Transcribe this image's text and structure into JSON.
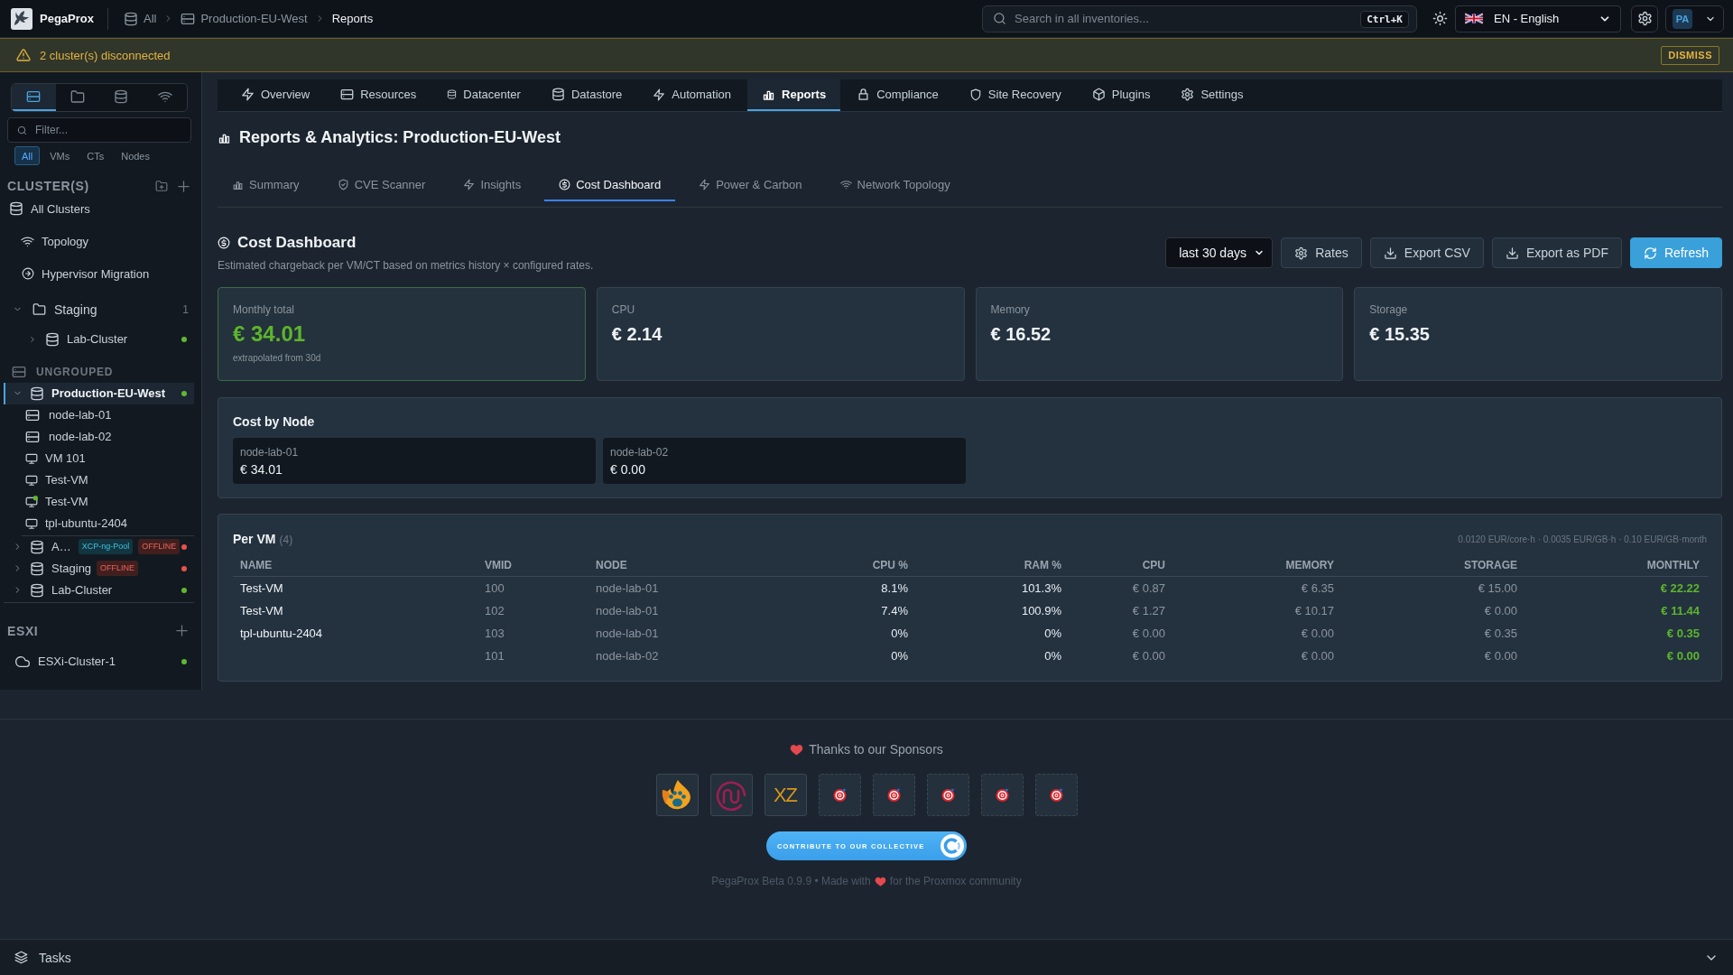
{
  "app": {
    "name": "PegaProx"
  },
  "breadcrumbs": [
    {
      "label": "All",
      "current": false
    },
    {
      "label": "Production-EU-West",
      "current": false
    },
    {
      "label": "Reports",
      "current": true
    }
  ],
  "search": {
    "placeholder": "Search in all inventories...",
    "shortcut": "Ctrl+K"
  },
  "language": {
    "value": "EN - English"
  },
  "user": {
    "initials": "PA"
  },
  "banner": {
    "message": "2 cluster(s) disconnected",
    "action": "DISMISS"
  },
  "sidebar": {
    "view_tabs": [
      {
        "selected": true
      },
      {
        "selected": false
      },
      {
        "selected": false
      },
      {
        "selected": false
      }
    ],
    "filter": {
      "placeholder": "Filter..."
    },
    "type_filters": [
      {
        "label": "All",
        "selected": true
      },
      {
        "label": "VMs",
        "selected": false
      },
      {
        "label": "CTs",
        "selected": false
      },
      {
        "label": "Nodes",
        "selected": false
      }
    ],
    "clusters_title": "CLUSTER(S)",
    "links": [
      {
        "label": "All Clusters"
      },
      {
        "label": "Topology"
      },
      {
        "label": "Hypervisor Migration"
      }
    ],
    "groups": [
      {
        "name": "Staging",
        "count": "1",
        "expanded": true,
        "clusters": [
          {
            "name": "Lab-Cluster",
            "expanded": false,
            "color": "#5fb832"
          }
        ]
      }
    ],
    "ungrouped": {
      "title": "UNGROUPED",
      "clusters": [
        {
          "name": "Production-EU-West",
          "selected": true,
          "expanded": true,
          "color": "#5fb832",
          "children": [
            {
              "name": "node-lab-01",
              "kind": "node"
            },
            {
              "name": "node-lab-02",
              "kind": "node"
            },
            {
              "name": "VM 101",
              "kind": "vm",
              "running": false
            },
            {
              "name": "Test-VM",
              "kind": "vm",
              "running": false
            },
            {
              "name": "Test-VM",
              "kind": "vm",
              "running": true
            },
            {
              "name": "tpl-ubuntu-2404",
              "kind": "vm",
              "running": false
            }
          ]
        },
        {
          "name": "A…",
          "selected": false,
          "expanded": false,
          "color": "#e5534b",
          "badges": [
            {
              "label": "XCP-ng-Pool",
              "kind": "type"
            },
            {
              "label": "OFFLINE",
              "kind": "offline"
            }
          ]
        },
        {
          "name": "Staging",
          "selected": false,
          "expanded": false,
          "color": "#e5534b",
          "badges": [
            {
              "label": "OFFLINE",
              "kind": "offline"
            }
          ]
        },
        {
          "name": "Lab-Cluster",
          "selected": false,
          "expanded": false,
          "color": "#5fb832"
        }
      ]
    },
    "esxi": {
      "title": "ESXI",
      "clusters": [
        {
          "name": "ESXi-Cluster-1",
          "color": "#5fb832"
        }
      ]
    }
  },
  "main": {
    "tabs": [
      {
        "label": "Overview",
        "selected": false
      },
      {
        "label": "Resources",
        "selected": false
      },
      {
        "label": "Datacenter",
        "selected": false
      },
      {
        "label": "Datastore",
        "selected": false
      },
      {
        "label": "Automation",
        "selected": false
      },
      {
        "label": "Reports",
        "selected": true
      },
      {
        "label": "Compliance",
        "selected": false
      },
      {
        "label": "Site Recovery",
        "selected": false
      },
      {
        "label": "Plugins",
        "selected": false
      },
      {
        "label": "Settings",
        "selected": false
      }
    ],
    "title": "Reports & Analytics: Production-EU-West",
    "sub_tabs": [
      {
        "label": "Summary",
        "selected": false
      },
      {
        "label": "CVE Scanner",
        "selected": false
      },
      {
        "label": "Insights",
        "selected": false
      },
      {
        "label": "Cost Dashboard",
        "selected": true
      },
      {
        "label": "Power & Carbon",
        "selected": false
      },
      {
        "label": "Network Topology",
        "selected": false
      }
    ],
    "cost_dashboard": {
      "title": "Cost Dashboard",
      "subtitle": "Estimated chargeback per VM/CT based on metrics history × configured rates.",
      "period": "last 30 days",
      "buttons": [
        {
          "label": "Rates",
          "kind": "default"
        },
        {
          "label": "Export CSV",
          "kind": "default"
        },
        {
          "label": "Export as PDF",
          "kind": "default"
        },
        {
          "label": "Refresh",
          "kind": "primary"
        }
      ],
      "summary": [
        {
          "label": "Monthly total",
          "value": "€ 34.01",
          "note": "extrapolated from 30d",
          "highlight": true
        },
        {
          "label": "CPU",
          "value": "€ 2.14",
          "highlight": false
        },
        {
          "label": "Memory",
          "value": "€ 16.52",
          "highlight": false
        },
        {
          "label": "Storage",
          "value": "€ 15.35",
          "highlight": false
        }
      ],
      "cost_by_node": {
        "title": "Cost by Node",
        "nodes": [
          {
            "name": "node-lab-01",
            "value": "€ 34.01"
          },
          {
            "name": "node-lab-02",
            "value": "€ 0.00"
          }
        ]
      },
      "per_vm": {
        "title": "Per VM",
        "count": "(4)",
        "rates": "0.0120 EUR/core·h · 0.0035 EUR/GB·h · 0.10 EUR/GB·month",
        "columns": [
          "NAME",
          "VMID",
          "NODE",
          "CPU %",
          "RAM %",
          "CPU",
          "MEMORY",
          "STORAGE",
          "MONTHLY"
        ],
        "rows": [
          {
            "name": "Test-VM",
            "vmid": "100",
            "node": "node-lab-01",
            "cpu_pct": "8.1%",
            "ram_pct": "101.3%",
            "cpu": "€ 0.87",
            "memory": "€ 6.35",
            "storage": "€ 15.00",
            "monthly": "€ 22.22"
          },
          {
            "name": "Test-VM",
            "vmid": "102",
            "node": "node-lab-01",
            "cpu_pct": "7.4%",
            "ram_pct": "100.9%",
            "cpu": "€ 1.27",
            "memory": "€ 10.17",
            "storage": "€ 0.00",
            "monthly": "€ 11.44"
          },
          {
            "name": "tpl-ubuntu-2404",
            "vmid": "103",
            "node": "node-lab-01",
            "cpu_pct": "0%",
            "ram_pct": "0%",
            "cpu": "€ 0.00",
            "memory": "€ 0.00",
            "storage": "€ 0.35",
            "monthly": "€ 0.35"
          },
          {
            "vmid": "101",
            "node": "node-lab-02",
            "cpu_pct": "0%",
            "ram_pct": "0%",
            "cpu": "€ 0.00",
            "memory": "€ 0.00",
            "storage": "€ 0.00",
            "monthly": "€ 0.00"
          }
        ]
      }
    }
  },
  "footer": {
    "sponsors_title": "Thanks to our Sponsors",
    "sponsors": [
      {
        "kind": "logo"
      },
      {
        "kind": "logo"
      },
      {
        "kind": "wordmark",
        "text": "XZ"
      },
      {
        "kind": "vacant"
      },
      {
        "kind": "vacant"
      },
      {
        "kind": "vacant"
      },
      {
        "kind": "vacant"
      },
      {
        "kind": "vacant"
      }
    ],
    "contribute": "CONTRIBUTE TO OUR COLLECTIVE",
    "credit_before": "PegaProx Beta 0.9.9 • Made with",
    "credit_after": "for the Proxmox community"
  },
  "tasks_bar": {
    "label": "Tasks"
  }
}
